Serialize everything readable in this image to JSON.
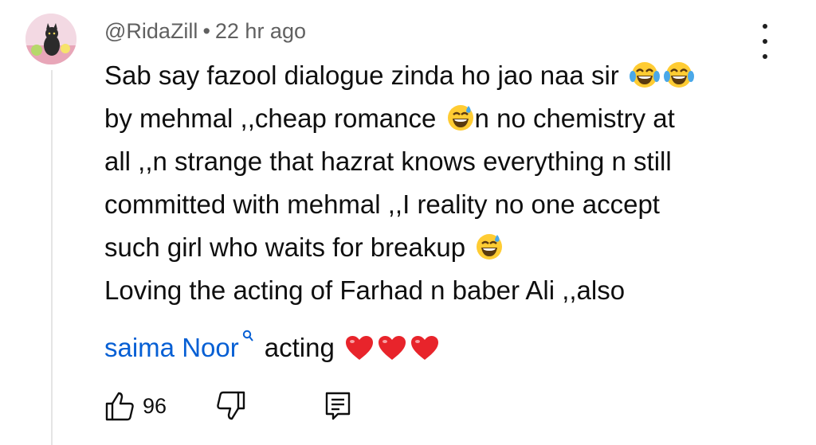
{
  "comment": {
    "author": "@RidaZill",
    "separator": "•",
    "timestamp": "22 hr ago",
    "lines": [
      "Sab say fazool dialogue zinda ho jao naa sir",
      "by mehmal ,,cheap romance",
      "n no chemistry at",
      "all ,,n strange that hazrat knows everything n still",
      "committed with mehmal ,,I reality no one accept",
      "such girl who waits for breakup",
      "Loving the acting of Farhad n baber Ali ,,also"
    ],
    "mention": "saima Noor",
    "mention_suffix": "acting",
    "emojis": [
      "laughing-tears-emoji",
      "laughing-tears-emoji",
      "sweat-smile-emoji",
      "sweat-smile-emoji",
      "red-heart-emoji",
      "red-heart-emoji",
      "red-heart-emoji"
    ]
  },
  "actions": {
    "like_count": "96"
  },
  "colors": {
    "text": "#0f0f0f",
    "meta": "#606060",
    "link": "#065fd4",
    "heart": "#e8242b",
    "emoji": "#ffcc33"
  }
}
